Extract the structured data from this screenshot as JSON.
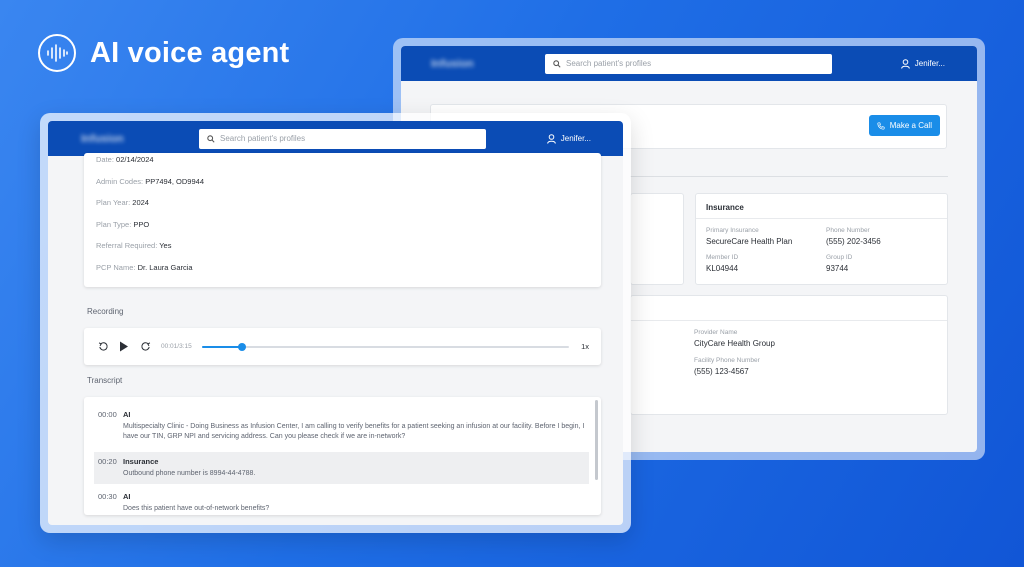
{
  "hero": {
    "title": "AI voice agent",
    "icon": "waveform-icon"
  },
  "back_window": {
    "logo": "Infusion",
    "search_placeholder": "Search patient's profiles",
    "user": "Jenifer...",
    "make_call": "Make a Call",
    "insurance": {
      "title": "Insurance",
      "primary_label": "Primary Insurance",
      "primary_value": "SecureCare Health Plan",
      "phone_label": "Phone Number",
      "phone_value": "(555) 202-3456",
      "member_label": "Member ID",
      "member_value": "KL04944",
      "group_label": "Group ID",
      "group_value": "93744"
    },
    "provider": {
      "name_label": "Provider Name",
      "name_value": "CityCare Health Group",
      "facility_phone_label": "Facility Phone Number",
      "facility_phone_value": "(555) 123-4567"
    }
  },
  "front_window": {
    "logo": "Infusion",
    "search_placeholder": "Search patient's profiles",
    "user": "Jenifer...",
    "plan": [
      {
        "label": "Date:",
        "value": "02/14/2024"
      },
      {
        "label": "Admin Codes:",
        "value": "PP7494, OD9944"
      },
      {
        "label": "Plan Year:",
        "value": "2024"
      },
      {
        "label": "Plan Type:",
        "value": "PPO"
      },
      {
        "label": "Referral Required:",
        "value": "Yes"
      },
      {
        "label": "PCP Name:",
        "value": "Dr. Laura Garcia"
      }
    ],
    "recording_label": "Recording",
    "player": {
      "time": "00:01/3:15",
      "speed": "1x",
      "progress": 0.11
    },
    "transcript_label": "Transcript",
    "transcript": [
      {
        "time": "00:00",
        "speaker": "AI",
        "text": "Multispecialty Clinic  - Doing Business as Infusion Center, I am calling to verify benefits for a patient seeking an infusion at our facility. Before I begin, I have our TIN, GRP NPI and servicing address. Can you please check if we are in-network?"
      },
      {
        "time": "00:20",
        "speaker": "Insurance",
        "text": "Outbound phone number is 8994-44-4788."
      },
      {
        "time": "00:30",
        "speaker": "AI",
        "text": "Does this patient have out-of-network benefits?"
      }
    ]
  },
  "colors": {
    "accent": "#1a8de8",
    "topbar": "#0b4cb5"
  }
}
